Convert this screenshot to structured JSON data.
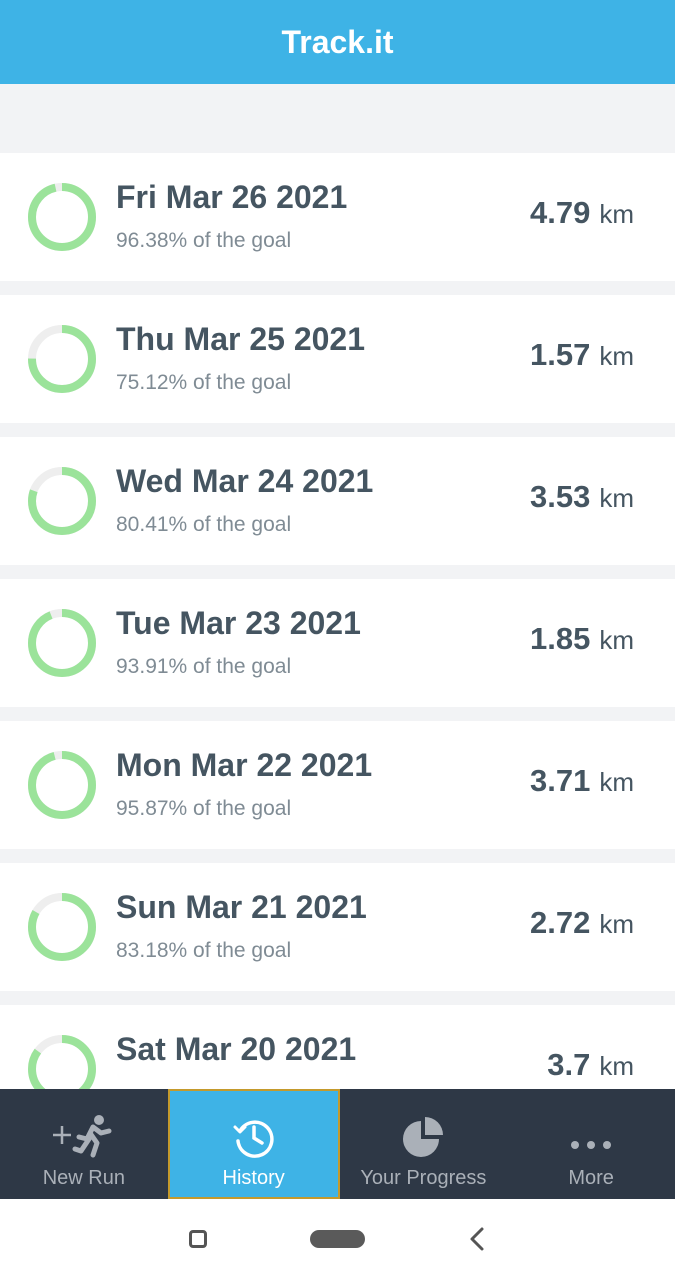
{
  "header": {
    "title": "Track.it"
  },
  "runs": [
    {
      "date": "Fri Mar 26 2021",
      "goal_text": "96.38% of the goal",
      "distance": "4.79",
      "unit": "km",
      "progress": 0.9638
    },
    {
      "date": "Thu Mar 25 2021",
      "goal_text": "75.12% of the goal",
      "distance": "1.57",
      "unit": "km",
      "progress": 0.7512
    },
    {
      "date": "Wed Mar 24 2021",
      "goal_text": "80.41% of the goal",
      "distance": "3.53",
      "unit": "km",
      "progress": 0.8041
    },
    {
      "date": "Tue Mar 23 2021",
      "goal_text": "93.91% of the goal",
      "distance": "1.85",
      "unit": "km",
      "progress": 0.9391
    },
    {
      "date": "Mon Mar 22 2021",
      "goal_text": "95.87% of the goal",
      "distance": "3.71",
      "unit": "km",
      "progress": 0.9587
    },
    {
      "date": "Sun Mar 21 2021",
      "goal_text": "83.18% of the goal",
      "distance": "2.72",
      "unit": "km",
      "progress": 0.8318
    },
    {
      "date": "Sat Mar 20 2021",
      "goal_text": "",
      "distance": "3.7",
      "unit": "km",
      "progress": 0.85
    }
  ],
  "tabs": [
    {
      "label": "New Run",
      "icon": "add-run-icon",
      "active": false
    },
    {
      "label": "History",
      "icon": "history-clock-icon",
      "active": true
    },
    {
      "label": "Your Progress",
      "icon": "pie-chart-icon",
      "active": false
    },
    {
      "label": "More",
      "icon": "more-dots-icon",
      "active": false
    }
  ],
  "colors": {
    "header": "#3eb3e6",
    "ring": "#9be39a",
    "ring_track": "#eeeeee",
    "tabbar": "#2e3846"
  }
}
